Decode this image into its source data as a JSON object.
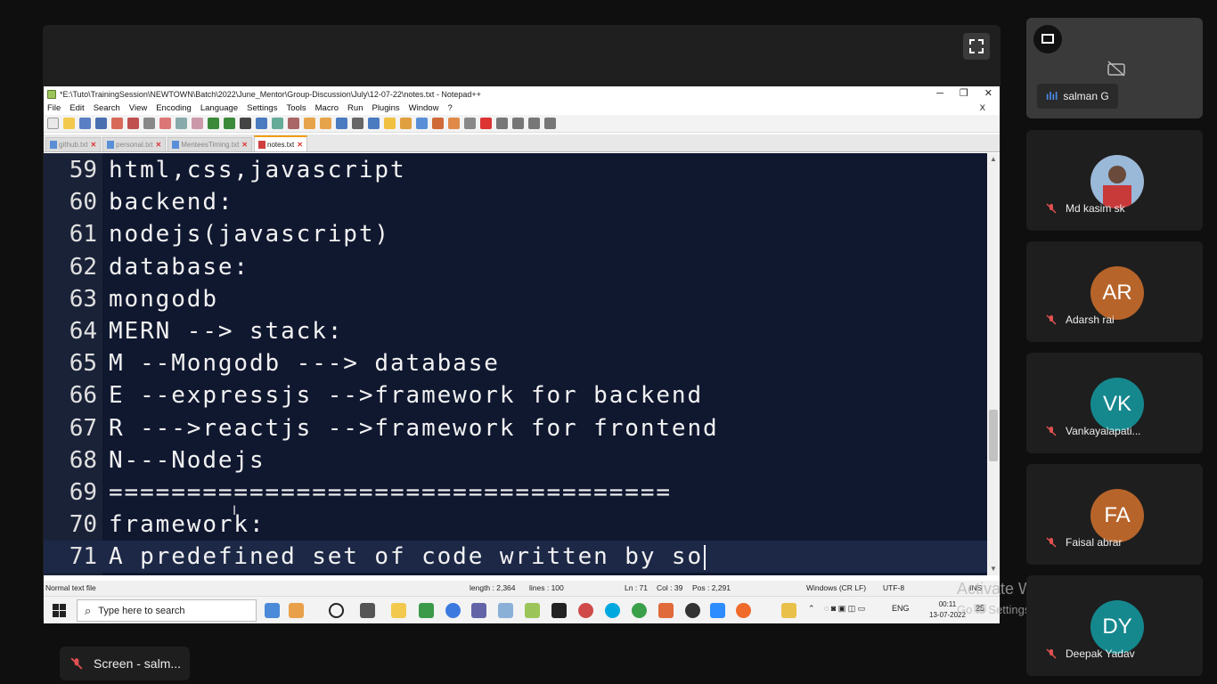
{
  "notepad": {
    "title": "*E:\\Tuto\\TrainingSession\\NEWTOWN\\Batch\\2022\\June_Mentor\\Group-Discussion\\July\\12-07-22\\notes.txt - Notepad++",
    "window_controls": {
      "minimize": "─",
      "maximize": "❐",
      "close": "✕"
    },
    "menu": [
      "File",
      "Edit",
      "Search",
      "View",
      "Encoding",
      "Language",
      "Settings",
      "Tools",
      "Macro",
      "Run",
      "Plugins",
      "Window",
      "?"
    ],
    "menu_doc_close": "X",
    "tabs": [
      "github.txt",
      "personal.txt",
      "MenteesTiming.txt",
      "notes.txt"
    ],
    "active_tab": "notes.txt",
    "lines": [
      {
        "num": "59",
        "text": "html,css,javascript"
      },
      {
        "num": "60",
        "text": "backend:"
      },
      {
        "num": "61",
        "text": "nodejs(javascript)"
      },
      {
        "num": "62",
        "text": "database:"
      },
      {
        "num": "63",
        "text": "mongodb"
      },
      {
        "num": "64",
        "text": "MERN --> stack:"
      },
      {
        "num": "65",
        "text": "M --Mongodb ---> database"
      },
      {
        "num": "66",
        "text": "E --expressjs -->framework for backend"
      },
      {
        "num": "67",
        "text": "R --->reactjs -->framework for frontend"
      },
      {
        "num": "68",
        "text": "N---Nodejs"
      },
      {
        "num": "69",
        "text": "===================================="
      },
      {
        "num": "70",
        "text": "framework:"
      },
      {
        "num": "71",
        "text": "A predefined set of code written by so"
      }
    ],
    "status": {
      "file_type": "Normal text file",
      "length": "length : 2,364",
      "lines": "lines : 100",
      "ln": "Ln : 71",
      "col": "Col : 39",
      "pos": "Pos : 2,291",
      "eol": "Windows (CR LF)",
      "encoding": "UTF-8",
      "mode": "INS"
    }
  },
  "taskbar": {
    "search_placeholder": "Type here to search",
    "lang": "ENG",
    "time": "00:11",
    "date": "13-07-2022",
    "notifications": "25"
  },
  "watermark": {
    "title": "Activate Windows",
    "subtitle": "Go to Settings to activate Windows."
  },
  "participants": [
    {
      "name": "salman G",
      "initials": "",
      "color": "#3a3a3a",
      "speaking": true
    },
    {
      "name": "Md kasim sk",
      "initials": "",
      "color": "#7a3a3a"
    },
    {
      "name": "Adarsh rai",
      "initials": "AR",
      "color": "#b7642a"
    },
    {
      "name": "Vankayalapati...",
      "initials": "VK",
      "color": "#15888e"
    },
    {
      "name": "Faisal abrar",
      "initials": "FA",
      "color": "#b7642a"
    },
    {
      "name": "Deepak Yadav",
      "initials": "DY",
      "color": "#15888e"
    }
  ],
  "screen_share": {
    "label": "Screen - salm..."
  }
}
